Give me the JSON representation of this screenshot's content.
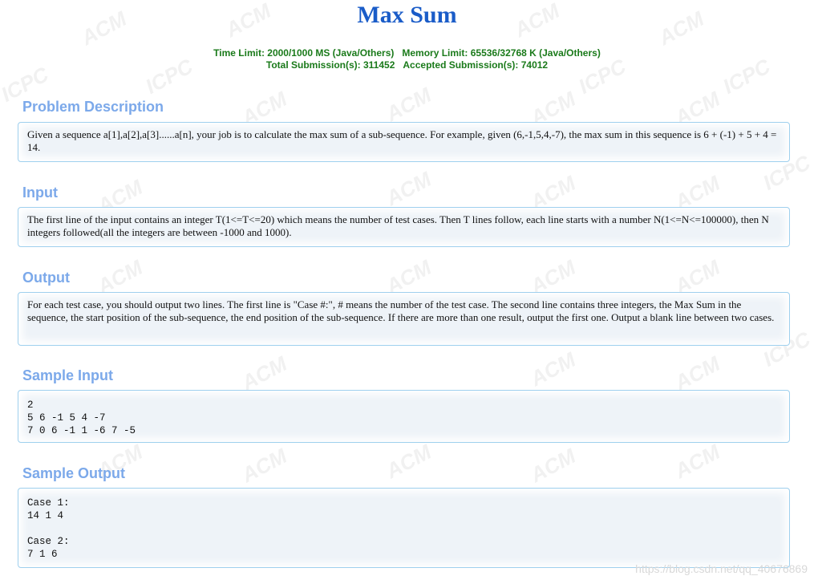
{
  "problem": {
    "title": "Max Sum",
    "time_limit": "Time Limit: 2000/1000 MS (Java/Others)",
    "memory_limit": "Memory Limit: 65536/32768 K (Java/Others)",
    "total_submissions": "Total Submission(s): 311452",
    "accepted_submissions": "Accepted Submission(s): 74012"
  },
  "sections": {
    "description": {
      "heading": "Problem Description",
      "text": "Given a sequence a[1],a[2],a[3]......a[n], your job is to calculate the max sum of a sub-sequence. For example, given (6,-1,5,4,-7), the max sum in this sequence is 6 + (-1) + 5 + 4 = 14."
    },
    "input": {
      "heading": "Input",
      "text": "The first line of the input contains an integer T(1<=T<=20) which means the number of test cases. Then T lines follow, each line starts with a number N(1<=N<=100000), then N integers followed(all the integers are between -1000 and 1000)."
    },
    "output": {
      "heading": "Output",
      "text": "For each test case, you should output two lines. The first line is \"Case #:\", # means the number of the test case. The second line contains three integers, the Max Sum in the sequence, the start position of the sub-sequence, the end position of the sub-sequence. If there are more than one result, output the first one. Output a blank line between two cases."
    },
    "sample_input": {
      "heading": "Sample Input",
      "text": "2\n5 6 -1 5 4 -7\n7 0 6 -1 1 -6 7 -5"
    },
    "sample_output": {
      "heading": "Sample Output",
      "text": "Case 1:\n14 1 4\n\nCase 2:\n7 1 6"
    }
  },
  "watermark": {
    "acm": "ACM",
    "icpc": "ICPC",
    "url": "https://blog.csdn.net/qq_40676869"
  }
}
